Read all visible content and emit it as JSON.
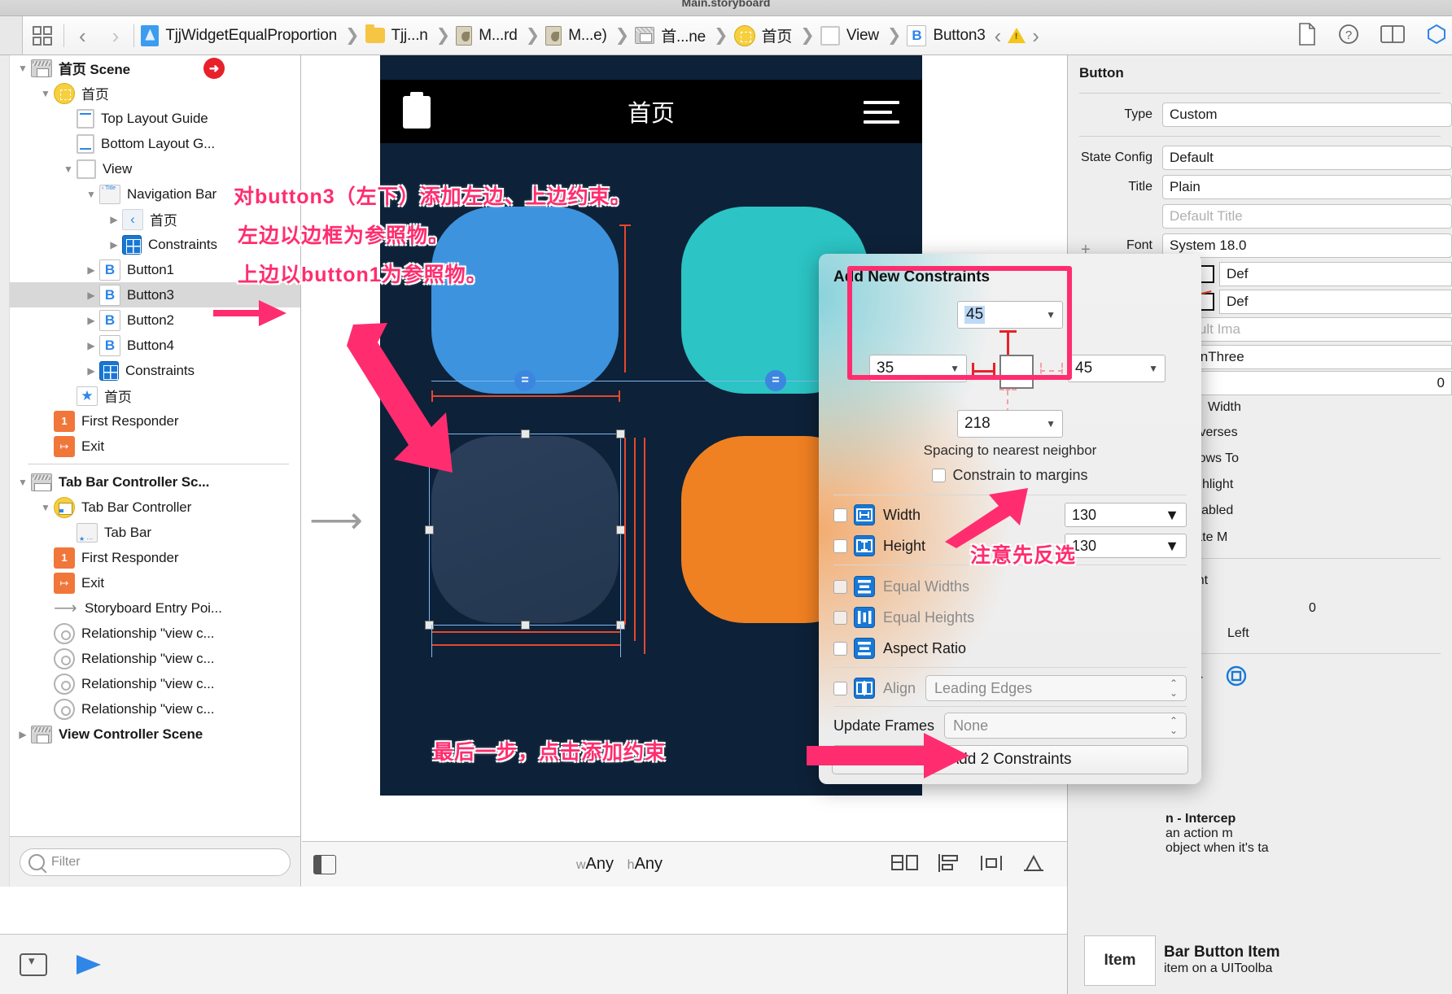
{
  "window": {
    "title": "Main.storyboard"
  },
  "jumpbar": {
    "back_icon": "chevron-left-icon",
    "forward_icon": "chevron-right-icon",
    "crumbs": [
      {
        "label": "TjjWidgetEqualProportion",
        "icon": "xcodeproj-icon"
      },
      {
        "label": "Tjj...n",
        "icon": "folder-icon"
      },
      {
        "label": "M...rd",
        "icon": "storyboard-file-icon"
      },
      {
        "label": "M...e)",
        "icon": "storyboard-file-icon"
      },
      {
        "label": "首...ne",
        "icon": "scene-icon"
      },
      {
        "label": "首页",
        "icon": "view-controller-icon"
      },
      {
        "label": "View",
        "icon": "view-icon"
      },
      {
        "label": "Button3",
        "icon": "button-icon"
      }
    ],
    "warning_icon": "warning-triangle-icon",
    "right_icons": [
      "document-icon",
      "help-icon",
      "assistant-editor-icon",
      "inspector-icon"
    ]
  },
  "navigator": {
    "items": [
      {
        "label": "首页 Scene",
        "icon": "scene-icon",
        "indent": 0,
        "twisty": "down",
        "bold": true,
        "badge": "entry-point-arrow"
      },
      {
        "label": "首页",
        "icon": "view-controller-icon",
        "indent": 1,
        "twisty": "down"
      },
      {
        "label": "Top Layout Guide",
        "icon": "top-layout-guide-icon",
        "indent": 2,
        "twisty": "none"
      },
      {
        "label": "Bottom Layout G...",
        "icon": "bottom-layout-guide-icon",
        "indent": 2,
        "twisty": "none"
      },
      {
        "label": "View",
        "icon": "view-icon",
        "indent": 2,
        "twisty": "down"
      },
      {
        "label": "Navigation Bar",
        "icon": "navigation-bar-icon",
        "indent": 3,
        "twisty": "down"
      },
      {
        "label": "首页",
        "icon": "back-item-icon",
        "indent": 4,
        "twisty": "right"
      },
      {
        "label": "Constraints",
        "icon": "constraints-icon",
        "indent": 4,
        "twisty": "right"
      },
      {
        "label": "Button1",
        "icon": "button-icon",
        "indent": 3,
        "twisty": "right"
      },
      {
        "label": "Button3",
        "icon": "button-icon",
        "indent": 3,
        "twisty": "right",
        "selected": true
      },
      {
        "label": "Button2",
        "icon": "button-icon",
        "indent": 3,
        "twisty": "right"
      },
      {
        "label": "Button4",
        "icon": "button-icon",
        "indent": 3,
        "twisty": "right"
      },
      {
        "label": "Constraints",
        "icon": "constraints-icon",
        "indent": 3,
        "twisty": "right"
      },
      {
        "label": "首页",
        "icon": "tab-bar-item-star-icon",
        "indent": 2,
        "twisty": "none"
      },
      {
        "label": "First Responder",
        "icon": "first-responder-icon",
        "indent": 1,
        "twisty": "none"
      },
      {
        "label": "Exit",
        "icon": "exit-icon",
        "indent": 1,
        "twisty": "none"
      },
      {
        "label": "Tab Bar Controller Sc...",
        "icon": "scene-tab-icon",
        "indent": 0,
        "twisty": "down",
        "bold": true,
        "divider_before": true
      },
      {
        "label": "Tab Bar Controller",
        "icon": "tab-bar-controller-icon",
        "indent": 1,
        "twisty": "down"
      },
      {
        "label": "Tab Bar",
        "icon": "tab-bar-icon",
        "indent": 2,
        "twisty": "none"
      },
      {
        "label": "First Responder",
        "icon": "first-responder-icon",
        "indent": 1,
        "twisty": "none"
      },
      {
        "label": "Exit",
        "icon": "exit-icon",
        "indent": 1,
        "twisty": "none"
      },
      {
        "label": "Storyboard Entry Poi...",
        "icon": "storyboard-entry-point-icon",
        "indent": 1,
        "twisty": "none"
      },
      {
        "label": "Relationship \"view c...",
        "icon": "relationship-icon",
        "indent": 1,
        "twisty": "none"
      },
      {
        "label": "Relationship \"view c...",
        "icon": "relationship-icon",
        "indent": 1,
        "twisty": "none"
      },
      {
        "label": "Relationship \"view c...",
        "icon": "relationship-icon",
        "indent": 1,
        "twisty": "none"
      },
      {
        "label": "Relationship \"view c...",
        "icon": "relationship-icon",
        "indent": 1,
        "twisty": "none"
      },
      {
        "label": "View Controller Scene",
        "icon": "scene-icon",
        "indent": 0,
        "twisty": "right",
        "bold": true
      }
    ],
    "filter_placeholder": "Filter"
  },
  "canvas": {
    "device_navbar_title": "首页",
    "size_class": {
      "prefix_w": "w",
      "width": "Any",
      "prefix_h": "h",
      "height": "Any"
    },
    "equal_badge": "=",
    "bottom_icons": [
      "resolve-auto-layout-issues-icon",
      "align-icon",
      "pin-icon",
      "embed-in-icon"
    ]
  },
  "popover": {
    "title": "Add New Constraints",
    "spacing_top": "45",
    "spacing_left": "35",
    "spacing_right": "45",
    "spacing_bottom": "218",
    "caption": "Spacing to nearest neighbor",
    "constrain_to_margins": "Constrain to margins",
    "constrain_to_margins_checked": false,
    "rows": [
      {
        "label": "Width",
        "icon": "width-constraint-icon",
        "checked": false,
        "value": "130",
        "enabled": true
      },
      {
        "label": "Height",
        "icon": "height-constraint-icon",
        "checked": false,
        "value": "130",
        "enabled": true
      },
      {
        "label": "Equal Widths",
        "icon": "equal-widths-icon",
        "checked": false,
        "value": null,
        "enabled": false
      },
      {
        "label": "Equal Heights",
        "icon": "equal-heights-icon",
        "checked": false,
        "value": null,
        "enabled": false
      },
      {
        "label": "Aspect Ratio",
        "icon": "aspect-ratio-icon",
        "checked": false,
        "value": null,
        "enabled": true
      }
    ],
    "align_label": "Align",
    "align_value": "Leading Edges",
    "update_frames_label": "Update Frames",
    "update_frames_value": "None",
    "add_button": "Add 2 Constraints"
  },
  "inspector": {
    "title": "Button",
    "rows": [
      {
        "label": "Type",
        "value": "Custom"
      },
      {
        "label": "State Config",
        "value": "Default"
      },
      {
        "label": "Title",
        "value": "Plain"
      },
      {
        "label": "",
        "value": "Default Title",
        "placeholder": true
      },
      {
        "label": "Font",
        "value": "System 18.0"
      }
    ],
    "plus_icon": "+",
    "swatch_rows": [
      {
        "swatch": "text-color-swatch",
        "value": "Def"
      },
      {
        "swatch": "shadow-color-swatch",
        "value": "Def"
      }
    ],
    "image_placeholder": "Default Ima",
    "identifier_value": "buttonThree",
    "shadow_offset": "0",
    "shadow_width_label": "Width",
    "checks": [
      {
        "label": "Reverses",
        "checked": false
      },
      {
        "label": "Shows To",
        "checked": false
      },
      {
        "label": "Highlight",
        "checked": true
      },
      {
        "label": "Disabled",
        "checked": true
      }
    ],
    "line_break": "Truncate M",
    "content_label": "Content",
    "content_value": "0",
    "content_align": "Left",
    "control_icons": [
      "{}",
      "alignment-icon"
    ],
    "footer_title": "Bar Button Item",
    "footer_lines": [
      "item on a UIToolba"
    ],
    "action_note_lines": [
      "n - Intercep",
      "an action m",
      "object when it's ta"
    ],
    "item_box_label": "Item"
  },
  "annotations": {
    "line1": "对button3（左下）添加左边、上边约束。",
    "line2": "左边以边框为参照物。",
    "line3": "上边以button1为参照物。",
    "note_deselect": "注意先反选",
    "note_final": "最后一步，点击添加约束"
  }
}
